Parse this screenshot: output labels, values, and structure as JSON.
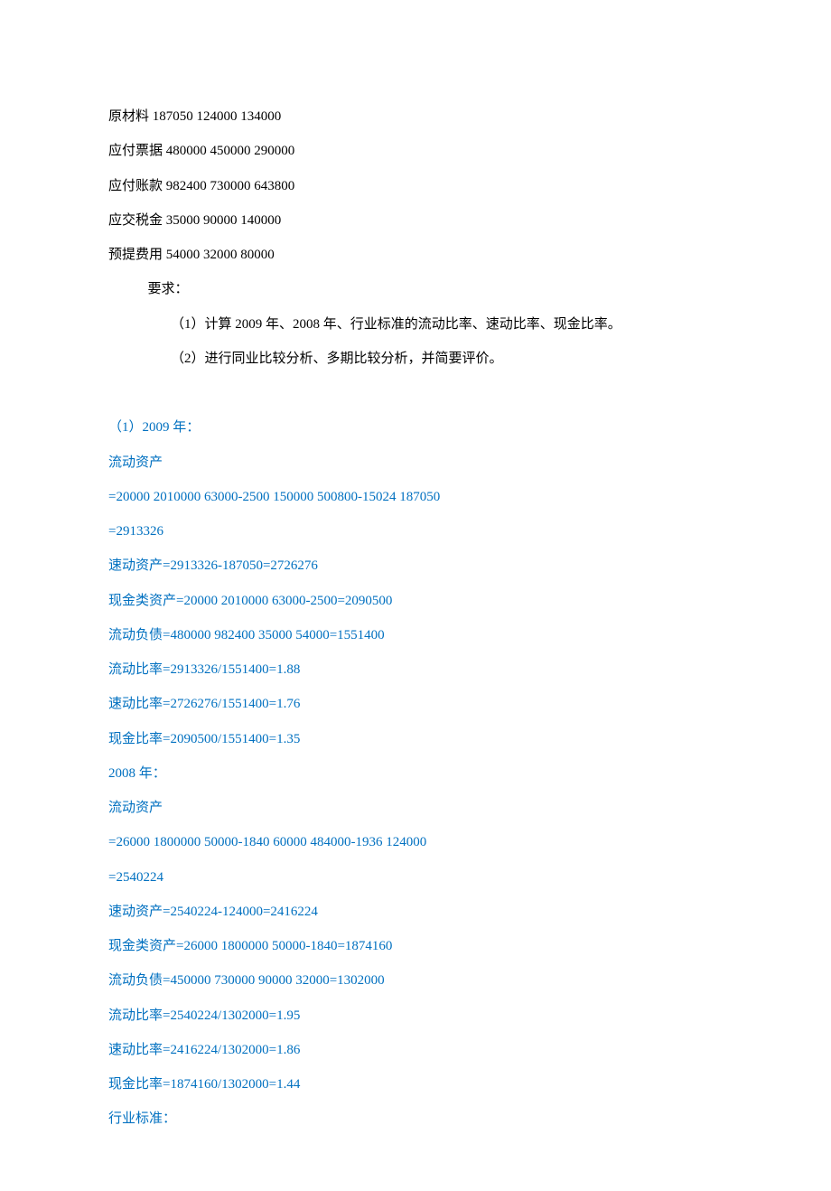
{
  "rows": [
    {
      "label": "原材料",
      "y2009": "187050",
      "y2008": "124000",
      "std": "134000"
    },
    {
      "label": "应付票据",
      "y2009": "480000",
      "y2008": "450000",
      "std": "290000"
    },
    {
      "label": "应付账款",
      "y2009": "982400",
      "y2008": "730000",
      "std": "643800"
    },
    {
      "label": "应交税金",
      "y2009": "35000",
      "y2008": "90000",
      "std": "140000"
    },
    {
      "label": "预提费用",
      "y2009": "54000",
      "y2008": "32000",
      "std": "80000"
    }
  ],
  "req_label": "要求：",
  "req1": "（1）计算 2009 年、2008 年、行业标准的流动比率、速动比率、现金比率。",
  "req2": "（2）进行同业比较分析、多期比较分析，并简要评价。",
  "ans": {
    "y2009_heading": "（1）2009 年：",
    "y2009": {
      "l1": "流动资产",
      "l2": "=20000 2010000 63000-2500 150000 500800-15024 187050",
      "l3": "=2913326",
      "l4": "速动资产=2913326-187050=2726276",
      "l5": "现金类资产=20000 2010000 63000-2500=2090500",
      "l6": "流动负债=480000 982400 35000 54000=1551400",
      "l7": "流动比率=2913326/1551400=1.88",
      "l8": "速动比率=2726276/1551400=1.76",
      "l9": "现金比率=2090500/1551400=1.35"
    },
    "y2008_heading": "2008 年：",
    "y2008": {
      "l1": "流动资产",
      "l2": "=26000 1800000 50000-1840 60000 484000-1936 124000",
      "l3": "=2540224",
      "l4": "速动资产=2540224-124000=2416224",
      "l5": "现金类资产=26000 1800000 50000-1840=1874160",
      "l6": "流动负债=450000 730000 90000 32000=1302000",
      "l7": "流动比率=2540224/1302000=1.95",
      "l8": "速动比率=2416224/1302000=1.86",
      "l9": "现金比率=1874160/1302000=1.44"
    },
    "std_heading": "行业标准："
  }
}
